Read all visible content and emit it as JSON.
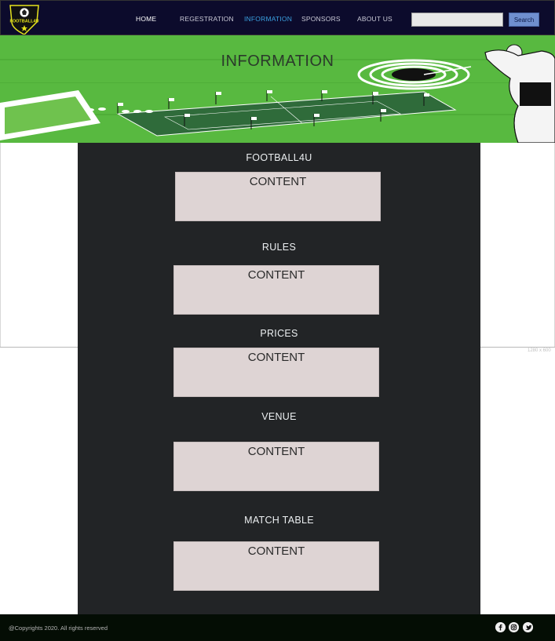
{
  "navbar": {
    "logo_text": "FOOTBALL4U",
    "items": [
      {
        "label": "HOME"
      },
      {
        "label": "REGESTRATION"
      },
      {
        "label": "INFORMATION"
      },
      {
        "label": "SPONSORS"
      },
      {
        "label": "ABOUT US"
      }
    ],
    "active_item": "INFORMATION",
    "search": {
      "placeholder": "",
      "button_label": "Search"
    }
  },
  "banner": {
    "title": "INFORMATION"
  },
  "sections": [
    {
      "title": "FOOTBALL4U",
      "content": "CONTENT"
    },
    {
      "title": "RULES",
      "content": "CONTENT"
    },
    {
      "title": "PRICES",
      "content": "CONTENT"
    },
    {
      "title": "VENUE",
      "content": "CONTENT"
    },
    {
      "title": "MATCH TABLE",
      "content": "CONTENT"
    }
  ],
  "size_hint": "1280 x 600",
  "footer": {
    "copyright": "@Copyrights 2020. All rights reserved",
    "social_icons": [
      "facebook-icon",
      "instagram-icon",
      "twitter-icon"
    ]
  },
  "colors": {
    "navbar_bg": "#0c0b2c",
    "active_nav": "#3aa0e0",
    "banner_green": "#58b940",
    "main_bg": "#222426",
    "content_box": "#ded4d4",
    "footer_bg": "#040d04",
    "search_button": "#6f8fcf"
  }
}
